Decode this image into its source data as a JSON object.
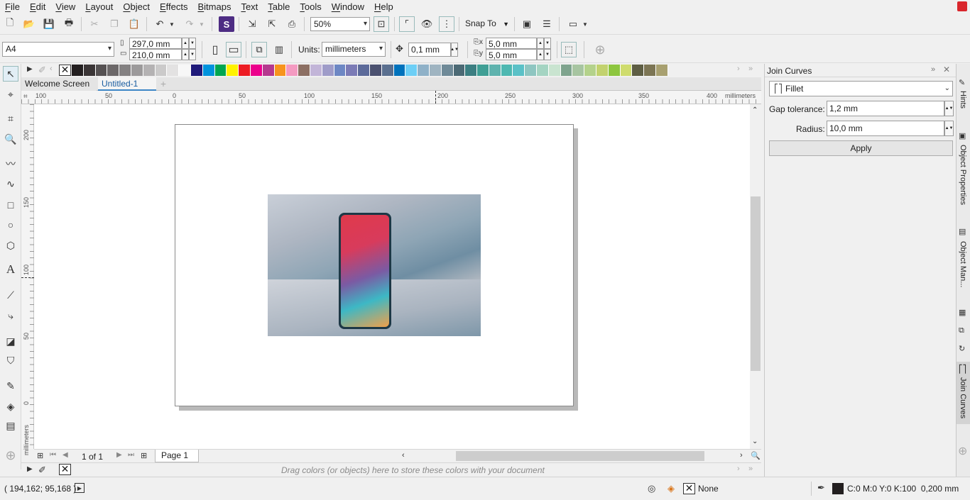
{
  "menu": [
    "File",
    "Edit",
    "View",
    "Layout",
    "Object",
    "Effects",
    "Bitmaps",
    "Text",
    "Table",
    "Tools",
    "Window",
    "Help"
  ],
  "toolbar": {
    "zoom": "50%",
    "snap_to": "Snap To"
  },
  "property_bar": {
    "page_size": "A4",
    "width": "297,0 mm",
    "height": "210,0 mm",
    "units_label": "Units:",
    "units": "millimeters",
    "nudge": "0,1 mm",
    "dup_x": "5,0 mm",
    "dup_y": "5,0 mm"
  },
  "palette": [
    "#231f20",
    "#3a3536",
    "#555152",
    "#6c6869",
    "#848182",
    "#9c9a9b",
    "#b4b2b3",
    "#cbcaca",
    "#e3e2e2",
    "#f7f7f7",
    "#1f1a7a",
    "#0093dd",
    "#00a651",
    "#fff200",
    "#ed1c24",
    "#ec008c",
    "#b5398f",
    "#f7941d",
    "#f49ac1",
    "#8c6f63",
    "#c2b5d8",
    "#9f9cc9",
    "#6d87c4",
    "#7b7bb6",
    "#5c6a9a",
    "#4b5170",
    "#5a6f8f",
    "#0072bc",
    "#6dcff6",
    "#8fb1c8",
    "#9fb4c1",
    "#6f8a98",
    "#4c6a75",
    "#3c7f82",
    "#3f9f95",
    "#5fb3ae",
    "#4db8b1",
    "#5ac1c7",
    "#8ec6c1",
    "#a4d4c2",
    "#c9e4d0",
    "#7fa48e",
    "#a7c5a1",
    "#b4d28b",
    "#c2d26e",
    "#8dc63f",
    "#cfdc6d",
    "#5e5e44",
    "#7c7554",
    "#a8a070"
  ],
  "tabs": {
    "welcome": "Welcome Screen",
    "doc": "Untitled-1"
  },
  "hruler": {
    "ticks": [
      "100",
      "50",
      "0",
      "50",
      "100",
      "150",
      "200",
      "250",
      "300",
      "350",
      "400"
    ],
    "unit": "millimeters"
  },
  "vruler": {
    "ticks": [
      "200",
      "150",
      "100",
      "50",
      "0"
    ],
    "unit": "millimeters"
  },
  "page_nav": {
    "counter": "1 of 1",
    "page_tab": "Page 1"
  },
  "docpalette": {
    "hint": "Drag colors (or objects) here to store these colors with your document"
  },
  "docker": {
    "title": "Join Curves",
    "mode": "Fillet",
    "gap_label": "Gap tolerance:",
    "gap_value": "1,2 mm",
    "radius_label": "Radius:",
    "radius_value": "10,0 mm",
    "apply": "Apply"
  },
  "sidetabs": [
    "Hints",
    "Object Properties",
    "Object Man...",
    "Join Curves"
  ],
  "status": {
    "coords": "( 194,162; 95,168 )",
    "fill": "None",
    "outline": "C:0 M:0 Y:0 K:100  0,200 mm"
  }
}
